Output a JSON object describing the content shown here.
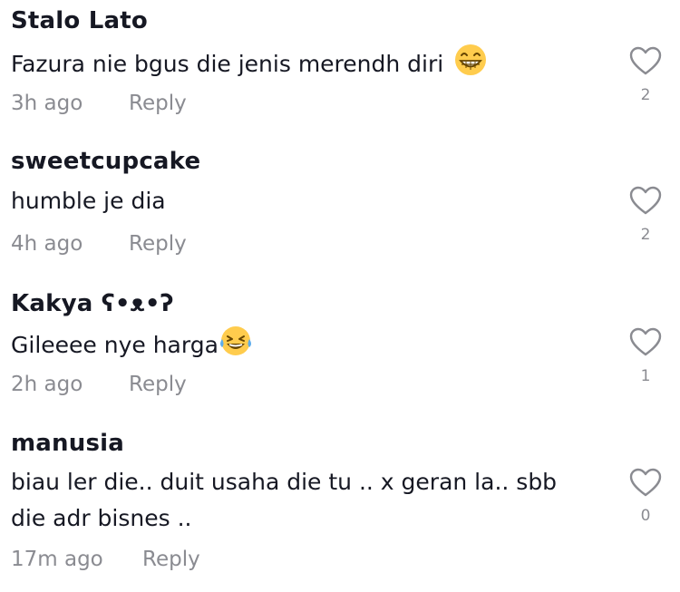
{
  "comments": [
    {
      "username": "Stalo Lato",
      "text": "Fazura nie bgus die jenis merendh diri",
      "emoji": "grinning-face",
      "time": "3h ago",
      "reply_label": "Reply",
      "likes": "2"
    },
    {
      "username": "sweetcupcake",
      "text": "humble je dia",
      "time": "4h ago",
      "reply_label": "Reply",
      "likes": "2"
    },
    {
      "username": "Kakya ʕ•ᴥ•ʔ",
      "text": "Gileeee nye harga",
      "emoji": "laughing-tears-face",
      "time": "2h ago",
      "reply_label": "Reply",
      "likes": "1"
    },
    {
      "username": "manusia",
      "text_line1": "biau ler die.. duit usaha die tu .. x geran la.. sbb",
      "text_line2": "die adr bisnes ..",
      "time": "17m ago",
      "reply_label": "Reply",
      "likes": "0"
    }
  ],
  "colors": {
    "text_primary": "#161823",
    "text_secondary": "#8a8b91",
    "icon": "#8a8b91"
  },
  "icons": {
    "like": "heart-outline-icon"
  }
}
